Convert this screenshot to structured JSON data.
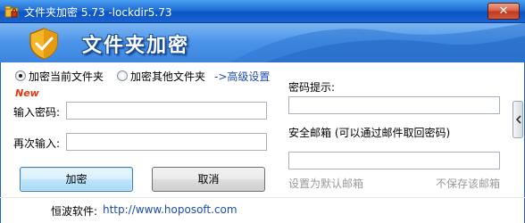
{
  "window": {
    "title": "文件夹加密 5.73 -lockdir5.73",
    "close_label": "✕"
  },
  "banner": {
    "title": "文件夹加密"
  },
  "options": {
    "current_folder_label": "加密当前文件夹",
    "other_folder_label": "加密其他文件夹",
    "selected": "current_folder",
    "advanced_link": "->高级设置",
    "new_badge": "New"
  },
  "form": {
    "password_label": "输入密码:",
    "password_value": "",
    "confirm_label": "再次输入:",
    "confirm_value": ""
  },
  "buttons": {
    "encrypt": "加密",
    "cancel": "取消"
  },
  "right_panel": {
    "hint_label": "密码提示:",
    "hint_value": "",
    "email_label": "安全邮箱 (可以通过邮件取回密码)",
    "email_value": "",
    "set_default_email": "设置为默认邮箱",
    "dont_save_email": "不保存该邮箱"
  },
  "footer": {
    "label": "恒波软件:",
    "link": "http://www.hoposoft.com"
  },
  "colors": {
    "title_bar": "#1f6fd6",
    "banner": "#4a93e8",
    "link": "#1d4bb3",
    "new_badge": "#e03a12",
    "close_button": "#c2391f"
  },
  "icons": {
    "app": "folder-lock-icon",
    "banner": "shield-icon",
    "side_toggle": "chevron-left-icon"
  }
}
